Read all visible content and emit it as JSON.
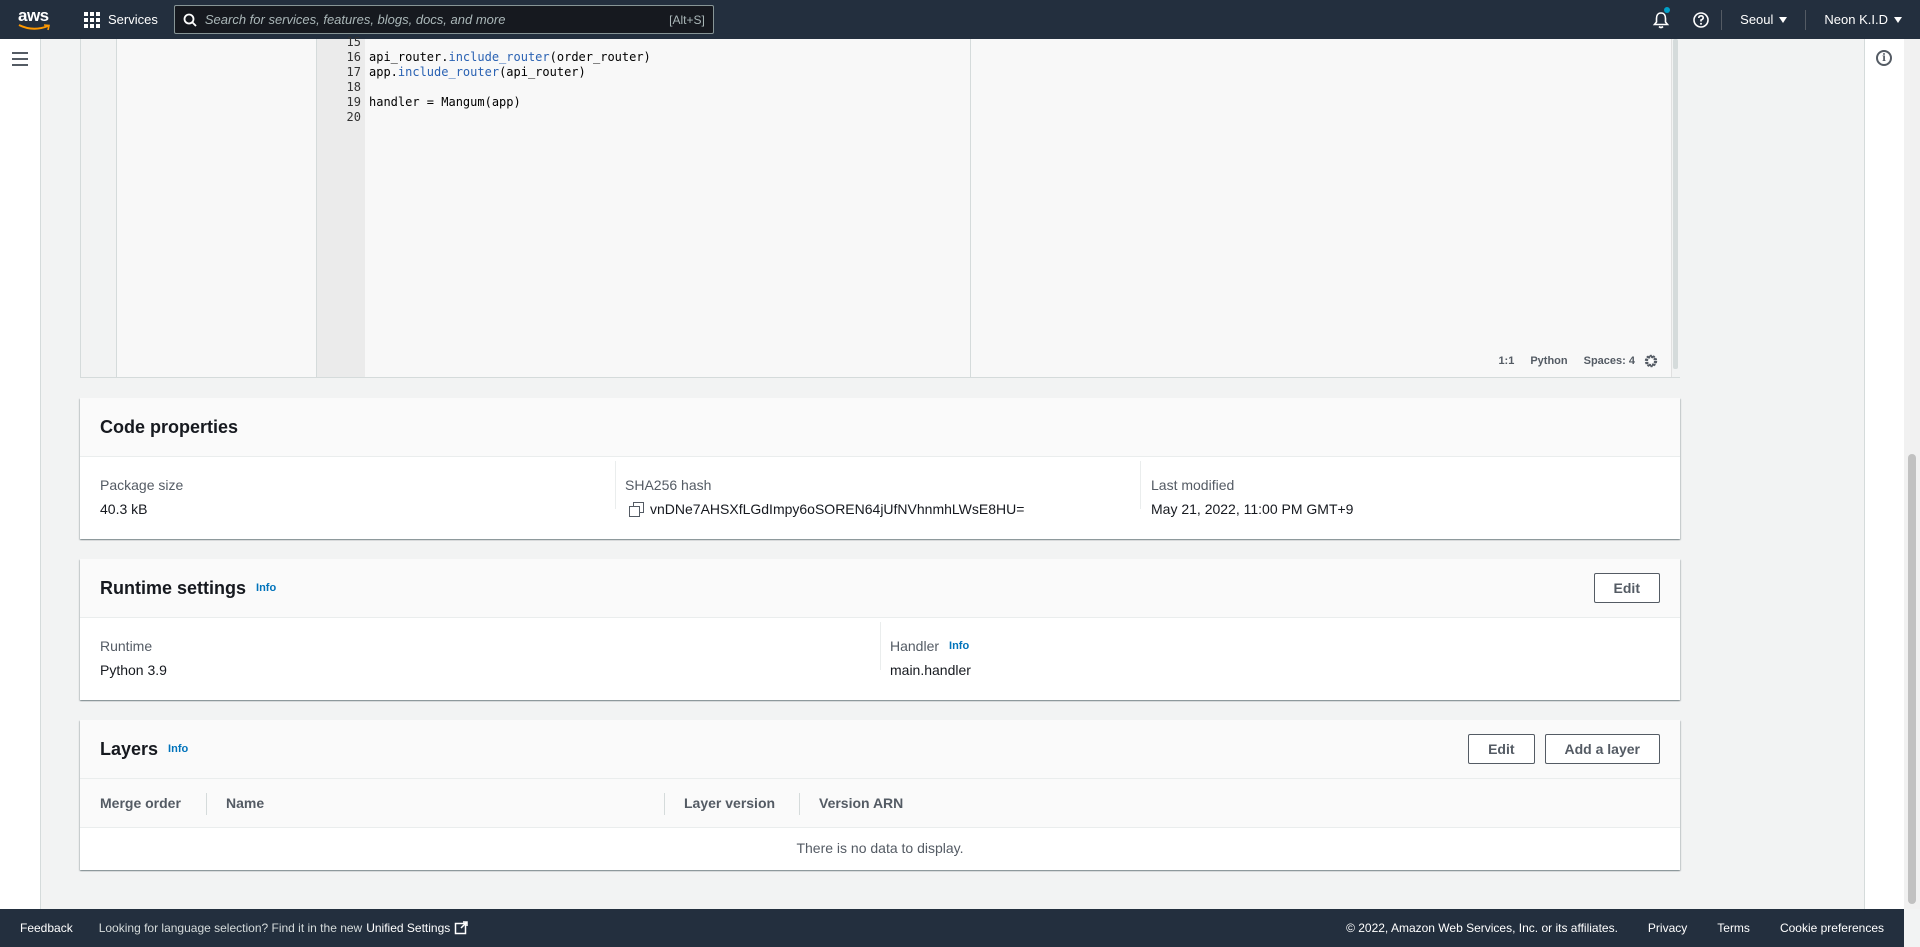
{
  "nav": {
    "logo": "aws",
    "services_label": "Services",
    "search_placeholder": "Search for services, features, blogs, docs, and more",
    "search_shortcut": "[Alt+S]",
    "region": "Seoul",
    "account": "Neon K.I.D",
    "icons": [
      "grid-icon",
      "search-icon",
      "bell-icon",
      "help-icon"
    ]
  },
  "editor": {
    "lines": [
      {
        "num": "15",
        "code": ""
      },
      {
        "num": "16",
        "code": "api_router.include_router(order_router)"
      },
      {
        "num": "17",
        "code": "app.include_router(api_router)"
      },
      {
        "num": "18",
        "code": ""
      },
      {
        "num": "19",
        "code": "handler = Mangum(app)"
      },
      {
        "num": "20",
        "code": ""
      }
    ],
    "status": {
      "position": "1:1",
      "language": "Python",
      "indent": "Spaces: 4"
    }
  },
  "code_properties": {
    "title": "Code properties",
    "package_size_label": "Package size",
    "package_size": "40.3 kB",
    "sha_label": "SHA256 hash",
    "sha": "vnDNe7AHSXfLGdImpy6oSOREN64jUfNVhnmhLWsE8HU=",
    "modified_label": "Last modified",
    "modified": "May 21, 2022, 11:00 PM GMT+9"
  },
  "runtime_settings": {
    "title": "Runtime settings",
    "info": "Info",
    "edit": "Edit",
    "runtime_label": "Runtime",
    "runtime": "Python 3.9",
    "handler_label": "Handler",
    "handler_info": "Info",
    "handler": "main.handler"
  },
  "layers": {
    "title": "Layers",
    "info": "Info",
    "edit": "Edit",
    "add": "Add a layer",
    "columns": [
      "Merge order",
      "Name",
      "Layer version",
      "Version ARN"
    ],
    "empty": "There is no data to display."
  },
  "footer": {
    "feedback": "Feedback",
    "lang_text": "Looking for language selection? Find it in the new",
    "unified": "Unified Settings",
    "copyright": "© 2022, Amazon Web Services, Inc. or its affiliates.",
    "privacy": "Privacy",
    "terms": "Terms",
    "cookies": "Cookie preferences"
  }
}
